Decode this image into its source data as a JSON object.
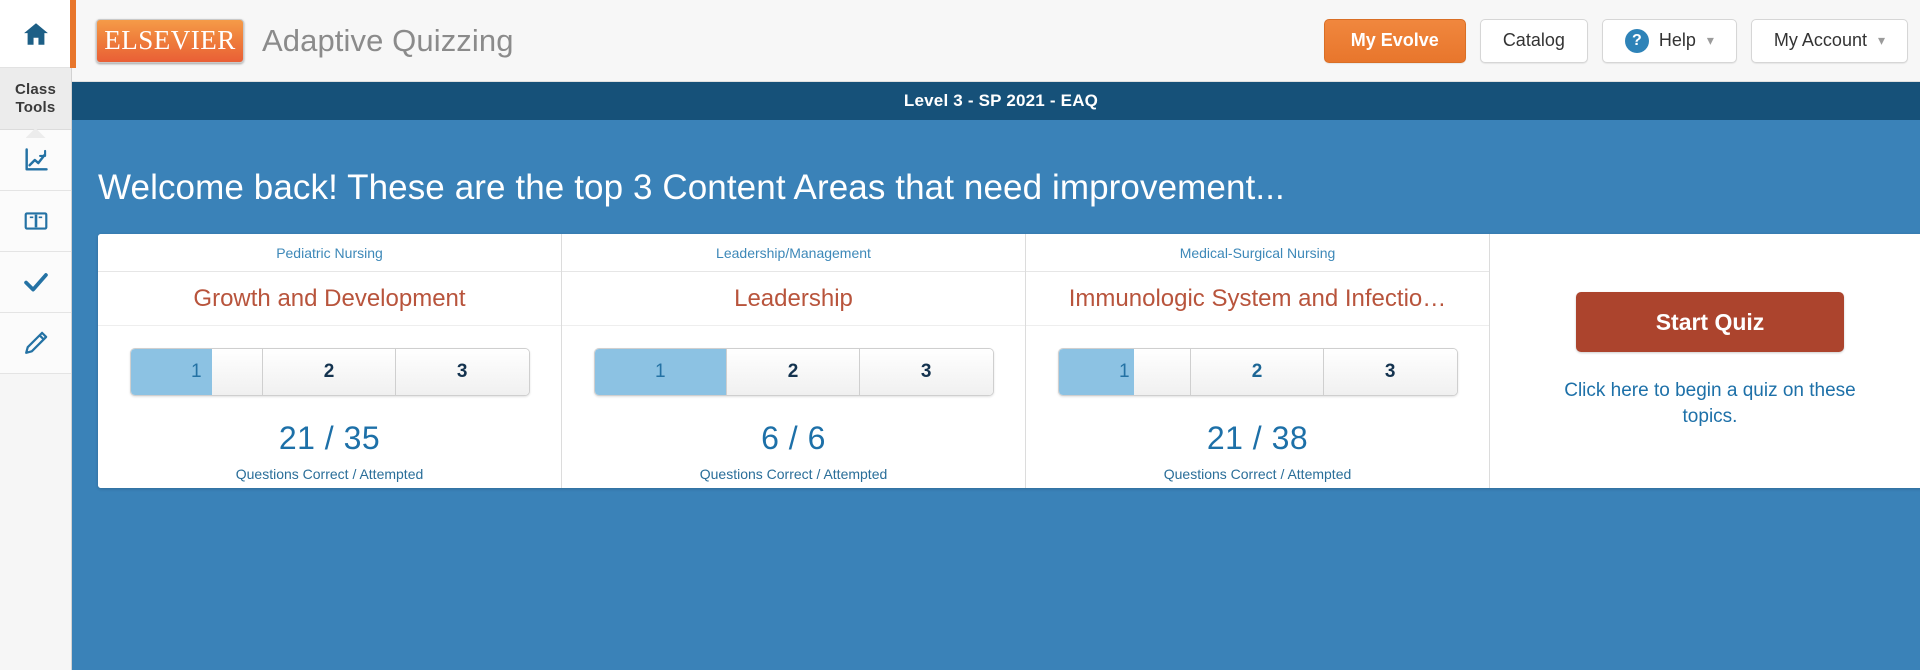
{
  "rail": {
    "home_icon": "home-icon",
    "class_tools_line1": "Class",
    "class_tools_line2": "Tools",
    "items": [
      {
        "icon": "chart-line-icon",
        "name": "performance"
      },
      {
        "icon": "book-icon",
        "name": "lessons"
      },
      {
        "icon": "check-icon",
        "name": "assignments"
      },
      {
        "icon": "pencil-icon",
        "name": "notes"
      }
    ]
  },
  "header": {
    "brand_logo": "ELSEVIER",
    "product_name": "Adaptive Quizzing",
    "my_evolve": "My Evolve",
    "catalog": "Catalog",
    "help": "Help",
    "my_account": "My Account",
    "help_icon": "question-circle-icon",
    "chevron_icon": "⌄",
    "accent_orange": "#e8762c",
    "accent_blue": "#2e83b8"
  },
  "course_bar": {
    "title": "Level 3 - SP 2021 - EAQ",
    "background": "#165179"
  },
  "main": {
    "welcome": "Welcome back! These are the top 3 Content Areas that need improvement...",
    "background": "#3a82b8",
    "cards": [
      {
        "category": "Pediatric Nursing",
        "topic": "Growth and Development",
        "levels": [
          "1",
          "2",
          "3"
        ],
        "current_level": 1,
        "level_progress_percent": 62,
        "score": "21 / 35",
        "score_label": "Questions Correct / Attempted",
        "correct": 21,
        "attempted": 35
      },
      {
        "category": "Leadership/Management",
        "topic": "Leadership",
        "levels": [
          "1",
          "2",
          "3"
        ],
        "current_level": 1,
        "level_progress_percent": 100,
        "score": "6 / 6",
        "score_label": "Questions Correct / Attempted",
        "correct": 6,
        "attempted": 6
      },
      {
        "category": "Medical-Surgical Nursing",
        "topic": "Immunologic System and Infectio…",
        "levels": [
          "1",
          "2",
          "3"
        ],
        "current_level": 1,
        "level_progress_percent": 57,
        "score": "21 / 38",
        "score_label": "Questions Correct / Attempted",
        "correct": 21,
        "attempted": 38
      }
    ],
    "action": {
      "start_label": "Start Quiz",
      "hint": "Click here to begin a quiz on these topics.",
      "button_color": "#ac442d"
    }
  }
}
